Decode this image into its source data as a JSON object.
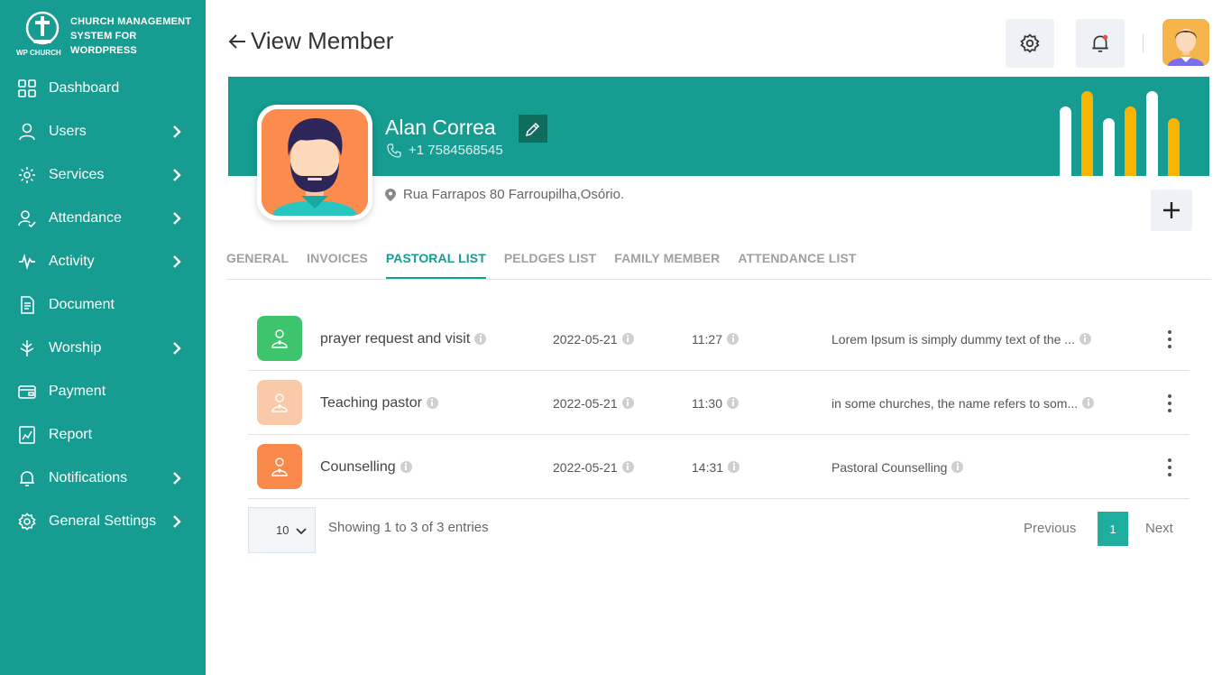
{
  "brand": {
    "line1": "CHURCH MANAGEMENT",
    "line2": "SYSTEM FOR",
    "line3": "WORDPRESS",
    "logo_text": "WP CHURCH"
  },
  "sidebar": {
    "items": [
      {
        "label": "Dashboard",
        "icon": "dashboard-icon",
        "has_submenu": false
      },
      {
        "label": "Users",
        "icon": "user-icon",
        "has_submenu": true
      },
      {
        "label": "Services",
        "icon": "services-icon",
        "has_submenu": true
      },
      {
        "label": "Attendance",
        "icon": "attendance-icon",
        "has_submenu": true
      },
      {
        "label": "Activity",
        "icon": "activity-icon",
        "has_submenu": true
      },
      {
        "label": "Document",
        "icon": "document-icon",
        "has_submenu": false
      },
      {
        "label": "Worship",
        "icon": "worship-icon",
        "has_submenu": true
      },
      {
        "label": "Payment",
        "icon": "payment-icon",
        "has_submenu": false
      },
      {
        "label": "Report",
        "icon": "report-icon",
        "has_submenu": false
      },
      {
        "label": "Notifications",
        "icon": "bell-icon",
        "has_submenu": true
      },
      {
        "label": "General Settings",
        "icon": "gear-icon",
        "has_submenu": true
      }
    ]
  },
  "header": {
    "title": "View Member"
  },
  "member": {
    "name": "Alan Correa",
    "phone": "+1 7584568545",
    "address": "Rua Farrapos 80 Farroupilha,Osório."
  },
  "tabs": [
    {
      "label": "GENERAL",
      "active": false
    },
    {
      "label": "INVOICES",
      "active": false
    },
    {
      "label": "PASTORAL LIST",
      "active": true
    },
    {
      "label": "PELDGES LIST",
      "active": false
    },
    {
      "label": "FAMILY MEMBER",
      "active": false
    },
    {
      "label": "ATTENDANCE LIST",
      "active": false
    }
  ],
  "pastoral_list": [
    {
      "title": "prayer request and visit",
      "date": "2022-05-21",
      "time": "11:27",
      "description": "Lorem Ipsum is simply dummy text of the ...",
      "icon_color": "#3ec46d"
    },
    {
      "title": "Teaching pastor",
      "date": "2022-05-21",
      "time": "11:30",
      "description": "in some churches, the name refers to som...",
      "icon_color": "#f9c9a8"
    },
    {
      "title": "Counselling",
      "date": "2022-05-21",
      "time": "14:31",
      "description": "Pastoral Counselling",
      "icon_color": "#f98a4b"
    }
  ],
  "pagination": {
    "page_size": "10",
    "showing": "Showing 1 to 3 of 3 entries",
    "previous": "Previous",
    "current_page": "1",
    "next": "Next"
  },
  "colors": {
    "primary": "#169c90",
    "accent_yellow": "#f9b400",
    "edit_button": "#0e6d5f"
  }
}
